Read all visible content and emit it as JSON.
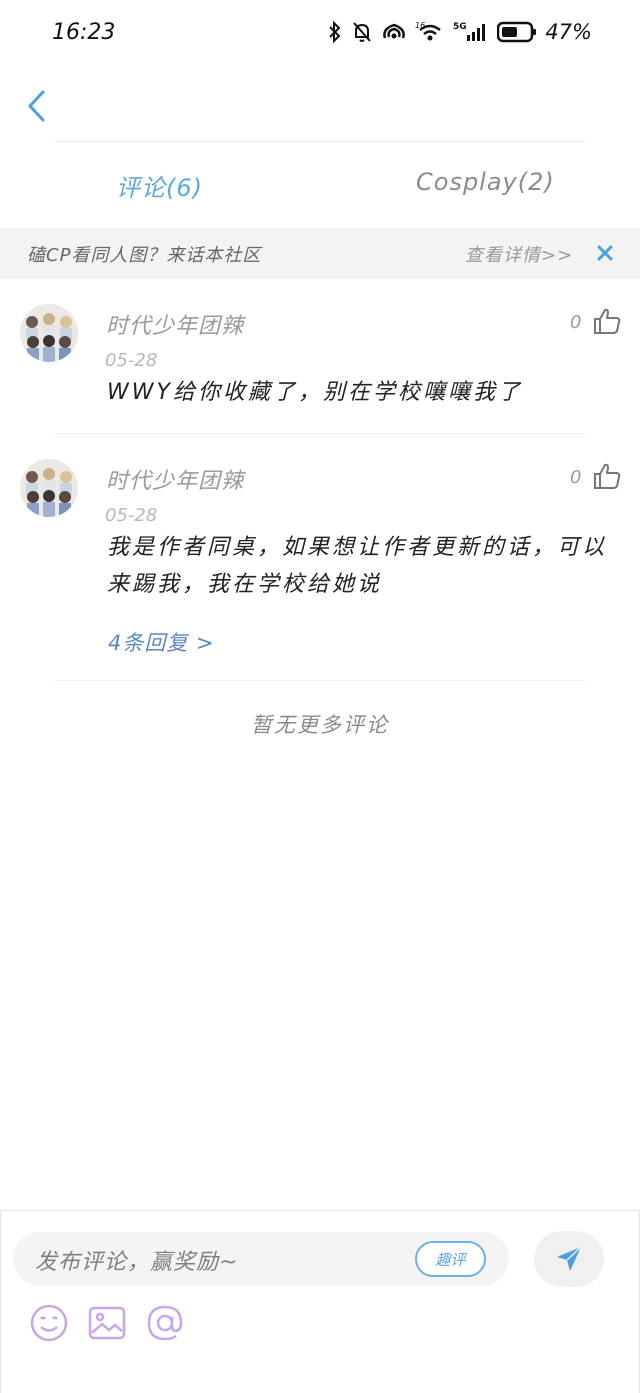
{
  "status": {
    "time": "16:23",
    "battery": "47%"
  },
  "tabs": [
    {
      "label": "评论(6)",
      "active": true
    },
    {
      "label": "Cosplay(2)",
      "active": false
    }
  ],
  "banner": {
    "text": "磕CP看同人图？来话本社区",
    "link": "查看详情>>"
  },
  "comments": [
    {
      "user": "时代少年团辣",
      "date": "05-28",
      "text": "WWY给你收藏了，别在学校嚷嚷我了",
      "likes": "0",
      "replies": ""
    },
    {
      "user": "时代少年团辣",
      "date": "05-28",
      "text": "我是作者同桌，如果想让作者更新的话，可以来踢我，我在学校给她说",
      "likes": "0",
      "replies": "4条回复 >"
    }
  ],
  "no_more": "暂无更多评论",
  "composer": {
    "placeholder": "发布评论，赢奖励~",
    "badge": "趣评"
  },
  "colors": {
    "accent": "#5da9dc",
    "reply_link": "#5b86c4",
    "tool_icons": "#c9a6e8"
  }
}
